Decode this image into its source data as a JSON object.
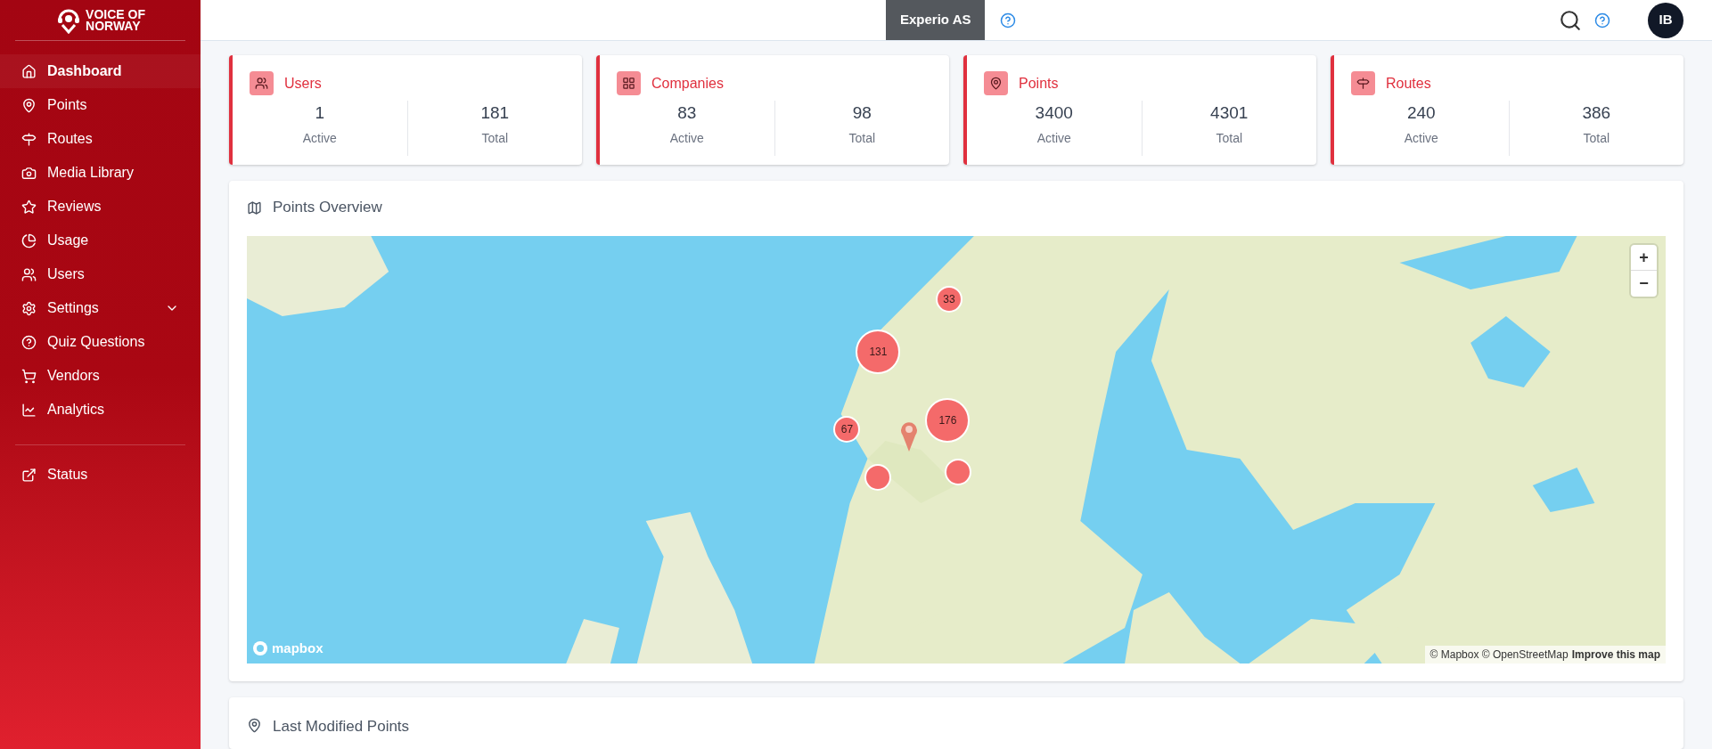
{
  "brand": {
    "line1": "VOICE OF",
    "line2": "NORWAY"
  },
  "sidebar": {
    "items": [
      {
        "label": "Dashboard",
        "selected": true
      },
      {
        "label": "Points",
        "selected": false
      },
      {
        "label": "Routes",
        "selected": false
      },
      {
        "label": "Media Library",
        "selected": false
      },
      {
        "label": "Reviews",
        "selected": false
      },
      {
        "label": "Usage",
        "selected": false
      },
      {
        "label": "Users",
        "selected": false
      },
      {
        "label": "Settings",
        "selected": false,
        "expandable": true
      },
      {
        "label": "Quiz Questions",
        "selected": false
      },
      {
        "label": "Vendors",
        "selected": false
      },
      {
        "label": "Analytics",
        "selected": false
      }
    ],
    "footer_items": [
      {
        "label": "Status",
        "selected": false
      }
    ]
  },
  "topbar": {
    "company": "Experio AS",
    "avatar": "IB"
  },
  "stats": [
    {
      "title": "Users",
      "active": "1",
      "active_label": "Active",
      "total": "181",
      "total_label": "Total"
    },
    {
      "title": "Companies",
      "active": "83",
      "active_label": "Active",
      "total": "98",
      "total_label": "Total"
    },
    {
      "title": "Points",
      "active": "3400",
      "active_label": "Active",
      "total": "4301",
      "total_label": "Total"
    },
    {
      "title": "Routes",
      "active": "240",
      "active_label": "Active",
      "total": "386",
      "total_label": "Total"
    }
  ],
  "map_card": {
    "title": "Points Overview",
    "clusters": [
      {
        "kind": "cluster",
        "count": "33"
      },
      {
        "kind": "cluster",
        "count": "131"
      },
      {
        "kind": "cluster",
        "count": "176"
      },
      {
        "kind": "cluster",
        "count": "67"
      },
      {
        "kind": "cluster"
      },
      {
        "kind": "cluster"
      }
    ],
    "zoom_in": "+",
    "zoom_out": "−",
    "logo": "mapbox",
    "attribution": "© Mapbox © OpenStreetMap",
    "improve_link": "Improve this map"
  },
  "last_modified": {
    "title": "Last Modified Points"
  }
}
